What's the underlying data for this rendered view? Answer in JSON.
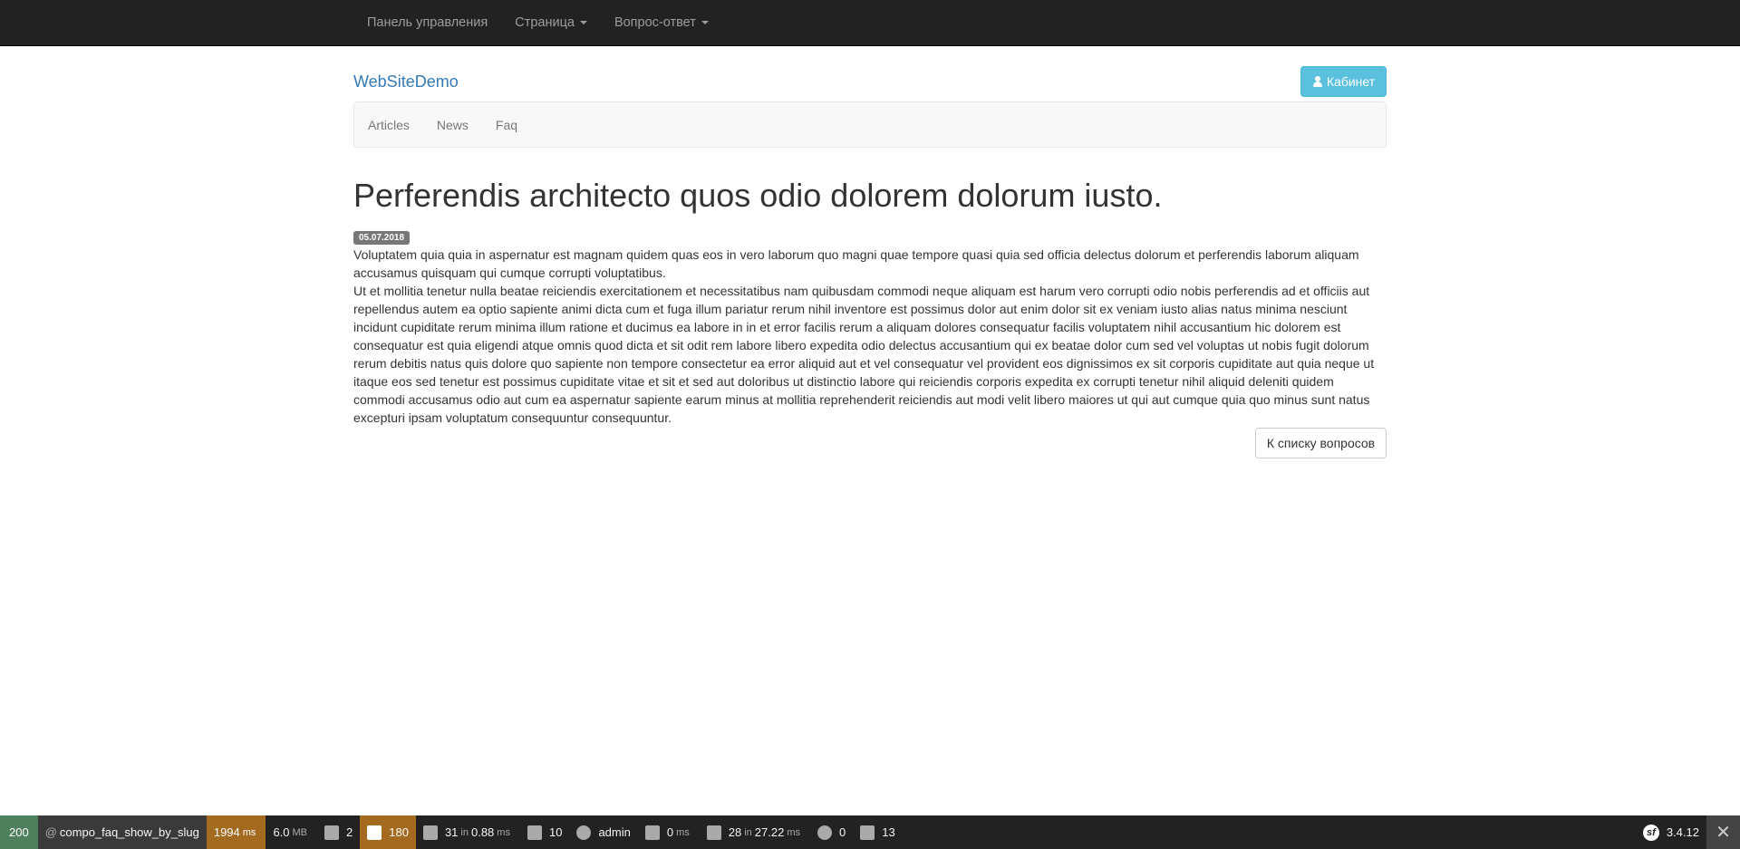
{
  "topbar": {
    "items": [
      {
        "label": "Панель управления",
        "has_caret": false
      },
      {
        "label": "Страница",
        "has_caret": true
      },
      {
        "label": "Вопрос-ответ",
        "has_caret": true
      }
    ]
  },
  "header": {
    "brand": "WebSiteDemo",
    "cabinet_label": "Кабинет"
  },
  "subnav": {
    "items": [
      "Articles",
      "News",
      "Faq"
    ]
  },
  "article": {
    "title": "Perferendis architecto quos odio dolorem dolorum iusto.",
    "date": "05.07.2018",
    "question": "Voluptatem quia quia in aspernatur est magnam quidem quas eos in vero laborum quo magni quae tempore quasi quia sed officia delectus dolorum et perferendis laborum aliquam accusamus quisquam qui cumque corrupti voluptatibus.",
    "answer": "Ut et mollitia tenetur nulla beatae reiciendis exercitationem et necessitatibus nam quibusdam commodi neque aliquam est harum vero corrupti odio nobis perferendis ad et officiis aut repellendus autem ea optio sapiente animi dicta cum et fuga illum pariatur rerum nihil inventore est possimus dolor aut enim dolor sit ex veniam iusto alias natus minima nesciunt incidunt cupiditate rerum minima illum ratione et ducimus ea labore in in et error facilis rerum a aliquam dolores consequatur facilis voluptatem nihil accusantium hic dolorem est consequatur est quia eligendi atque omnis quod dicta et sit odit rem labore libero expedita odio delectus accusantium qui ex beatae dolor cum sed vel voluptas ut nobis fugit dolorum rerum debitis natus quis dolore quo sapiente non tempore consectetur ea error aliquid aut et vel consequatur vel provident eos dignissimos ex sit corporis cupiditate aut quia neque ut itaque eos sed tenetur est possimus cupiditate vitae et sit et sed aut doloribus ut distinctio labore qui reiciendis corporis expedita ex corrupti tenetur nihil aliquid deleniti quidem commodi accusamus odio aut cum ea aspernatur sapiente earum minus at mollitia reprehenderit reiciendis aut modi velit libero maiores ut qui aut cumque quia quo minus sunt natus excepturi ipsam voluptatum consequuntur consequuntur.",
    "back_label": "К списку вопросов"
  },
  "toolbar": {
    "status": "200",
    "route_at": "@",
    "route": "compo_faq_show_by_slug",
    "time_value": "1994",
    "time_unit": "ms",
    "memory_value": "6.0",
    "memory_unit": "MB",
    "forms_count": "2",
    "logs_count": "180",
    "cache_count": "31",
    "cache_in": "in",
    "cache_time": "0.88",
    "cache_unit": "ms",
    "translations_count": "10",
    "user": "admin",
    "twig_time": "0",
    "twig_unit": "ms",
    "db_count": "28",
    "db_in": "in",
    "db_time": "27.22",
    "db_unit": "ms",
    "events_count": "0",
    "panels_count": "13",
    "version": "3.4.12",
    "close_label": "✕"
  },
  "colors": {
    "topbar_bg": "#222222",
    "brand": "#337ab7",
    "cabinet_btn": "#5bc0de",
    "status_ok": "#4f805d",
    "toolbar_warning": "#a46a1f"
  }
}
